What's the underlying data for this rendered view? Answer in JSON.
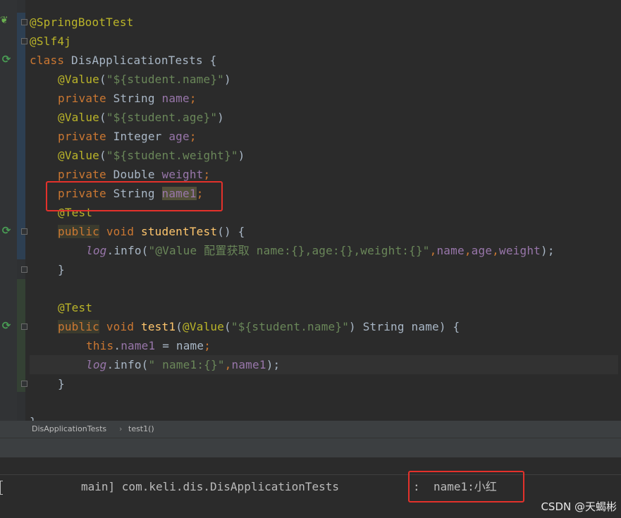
{
  "editor": {
    "lines": [
      [
        {
          "t": "@SpringBootTest",
          "c": "ann"
        }
      ],
      [
        {
          "t": "@Slf4j",
          "c": "ann"
        }
      ],
      [
        {
          "t": "class ",
          "c": "kw"
        },
        {
          "t": "DisApplicationTests {",
          "c": ""
        }
      ],
      [
        {
          "t": "@Value",
          "c": "ann"
        },
        {
          "t": "(",
          "c": ""
        },
        {
          "t": "\"${student.name}\"",
          "c": "str"
        },
        {
          "t": ")",
          "c": ""
        }
      ],
      [
        {
          "t": "private ",
          "c": "kw"
        },
        {
          "t": "String ",
          "c": ""
        },
        {
          "t": "name",
          "c": "fld"
        },
        {
          "t": ";",
          "c": "kw"
        }
      ],
      [
        {
          "t": "@Value",
          "c": "ann"
        },
        {
          "t": "(",
          "c": ""
        },
        {
          "t": "\"${student.age}\"",
          "c": "str"
        },
        {
          "t": ")",
          "c": ""
        }
      ],
      [
        {
          "t": "private ",
          "c": "kw"
        },
        {
          "t": "Integer ",
          "c": ""
        },
        {
          "t": "age",
          "c": "fld"
        },
        {
          "t": ";",
          "c": "kw"
        }
      ],
      [
        {
          "t": "@Value",
          "c": "ann"
        },
        {
          "t": "(",
          "c": ""
        },
        {
          "t": "\"${student.weight}\"",
          "c": "str"
        },
        {
          "t": ")",
          "c": ""
        }
      ],
      [
        {
          "t": "private ",
          "c": "kw"
        },
        {
          "t": "Double ",
          "c": ""
        },
        {
          "t": "weight",
          "c": "fld"
        },
        {
          "t": ";",
          "c": "kw"
        }
      ],
      [
        {
          "t": "private ",
          "c": "kw"
        },
        {
          "t": "String ",
          "c": ""
        },
        {
          "t": "name1",
          "c": "fld hl-name"
        },
        {
          "t": ";",
          "c": "kw"
        }
      ],
      [
        {
          "t": "@Test",
          "c": "ann"
        }
      ],
      [
        {
          "t": "public",
          "c": "kw hl-kw"
        },
        {
          "t": " ",
          "c": ""
        },
        {
          "t": "void ",
          "c": "kw"
        },
        {
          "t": "studentTest",
          "c": "fn"
        },
        {
          "t": "() {",
          "c": ""
        }
      ],
      [
        {
          "t": "log",
          "c": "fld it"
        },
        {
          "t": ".info(",
          "c": ""
        },
        {
          "t": "\"@Value 配置获取 name:{},age:{},weight:{}\"",
          "c": "str"
        },
        {
          "t": ",",
          "c": "kw"
        },
        {
          "t": "name",
          "c": "fld"
        },
        {
          "t": ",",
          "c": "kw"
        },
        {
          "t": "age",
          "c": "fld"
        },
        {
          "t": ",",
          "c": "kw"
        },
        {
          "t": "weight",
          "c": "fld"
        },
        {
          "t": ");",
          "c": ""
        }
      ],
      [
        {
          "t": "}",
          "c": ""
        }
      ],
      [],
      [
        {
          "t": "@Test",
          "c": "ann"
        }
      ],
      [
        {
          "t": "public",
          "c": "kw hl-kw"
        },
        {
          "t": " ",
          "c": ""
        },
        {
          "t": "void ",
          "c": "kw"
        },
        {
          "t": "test1",
          "c": "fn"
        },
        {
          "t": "(",
          "c": ""
        },
        {
          "t": "@Value",
          "c": "ann"
        },
        {
          "t": "(",
          "c": ""
        },
        {
          "t": "\"${student.name}\"",
          "c": "str"
        },
        {
          "t": ") String name) {",
          "c": ""
        }
      ],
      [
        {
          "t": "this",
          "c": "kw"
        },
        {
          "t": ".",
          "c": ""
        },
        {
          "t": "name1",
          "c": "fld"
        },
        {
          "t": " = name",
          "c": ""
        },
        {
          "t": ";",
          "c": "kw"
        }
      ],
      [
        {
          "t": "log",
          "c": "fld it"
        },
        {
          "t": ".info(",
          "c": ""
        },
        {
          "t": "\" name1:{}\"",
          "c": "str"
        },
        {
          "t": ",",
          "c": "kw"
        },
        {
          "t": "name1",
          "c": "fld"
        },
        {
          "t": ");",
          "c": ""
        }
      ],
      [
        {
          "t": "}",
          "c": ""
        }
      ],
      [],
      [
        {
          "t": "}",
          "c": ""
        }
      ]
    ],
    "indents": [
      0,
      0,
      0,
      1,
      1,
      1,
      1,
      1,
      1,
      1,
      1,
      1,
      2,
      1,
      0,
      1,
      1,
      2,
      2,
      1,
      0,
      0
    ]
  },
  "breadcrumb": {
    "items": [
      "DisApplicationTests",
      "test1()"
    ],
    "separator": "›"
  },
  "console": {
    "thread": "main] com.keli.dis.DisApplicationTests",
    "separator": ":",
    "message": "name1:小红"
  },
  "watermark": "CSDN @天蝎彬",
  "colors": {
    "annotation": "#bbb529",
    "keyword": "#cc7832",
    "string": "#6a8759",
    "field": "#9876aa",
    "method": "#ffc66d",
    "highlight_box": "#e4312b"
  },
  "icons": {
    "run_gutter": "run-test-icon",
    "spring_leaf": "spring-leaf-icon"
  }
}
